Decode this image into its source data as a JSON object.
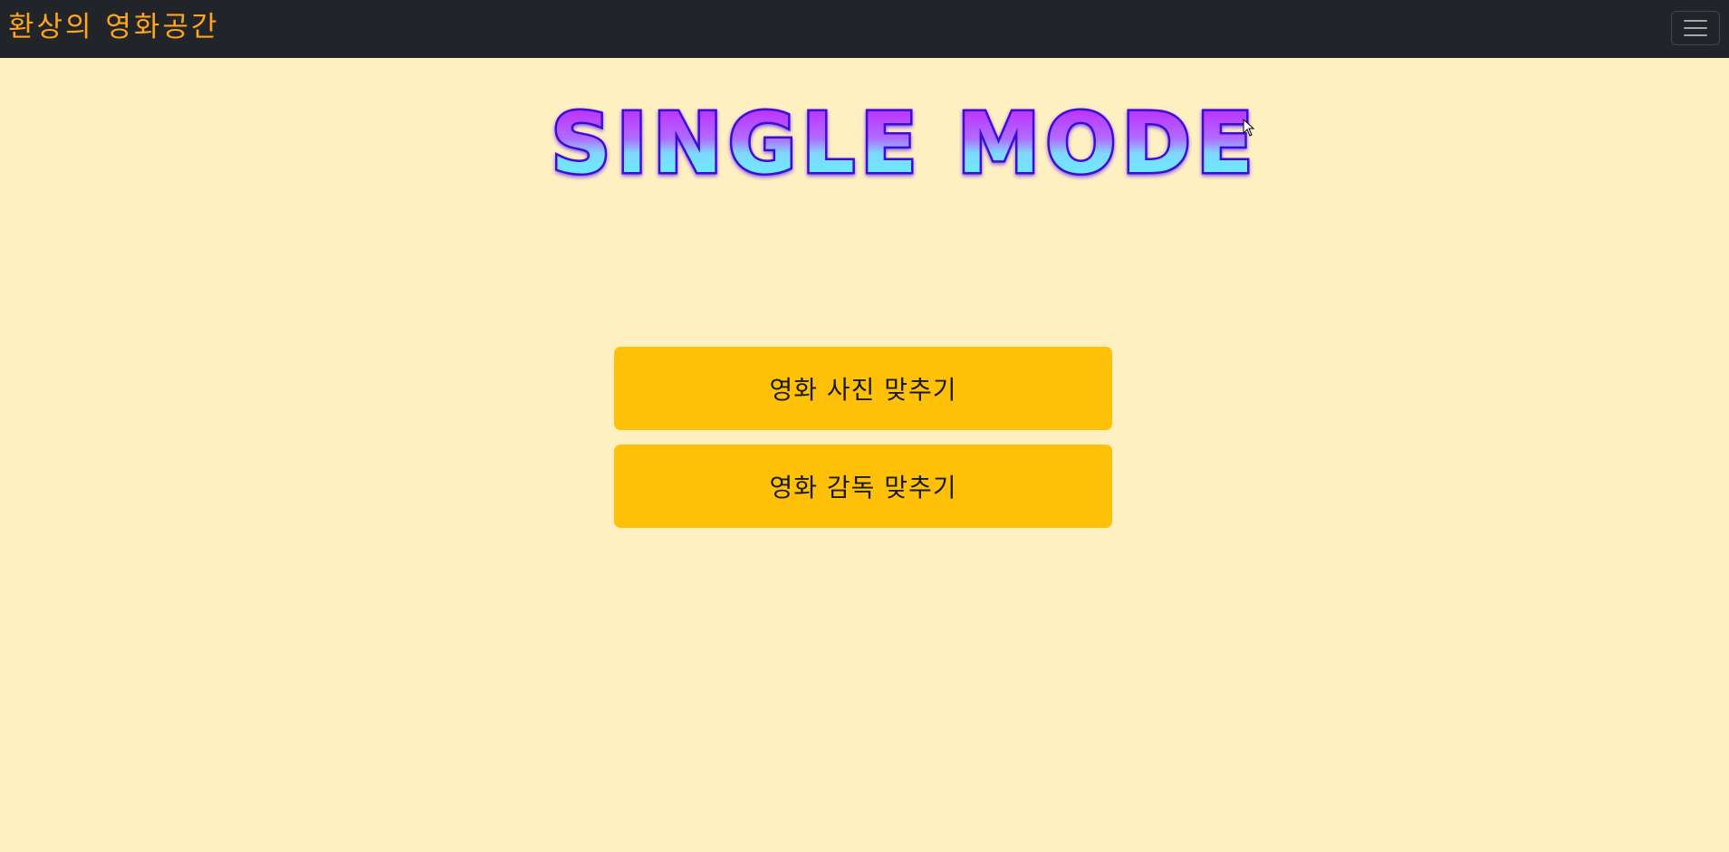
{
  "navbar": {
    "brand": "환상의 영화공간",
    "brand_color": "#ffa41b",
    "background": "#212529",
    "toggler_icon": "hamburger-menu-icon"
  },
  "main": {
    "title": "SINGLE MODE",
    "title_gradient_top": "#c415ff",
    "title_gradient_bottom": "#5cfbff",
    "title_stroke": "#3a0bd6",
    "buttons": [
      {
        "label": "영화 사진 맞추기"
      },
      {
        "label": "영화 감독 맞추기"
      }
    ],
    "button_color": "#ffc107",
    "background": "#fff0c2"
  }
}
